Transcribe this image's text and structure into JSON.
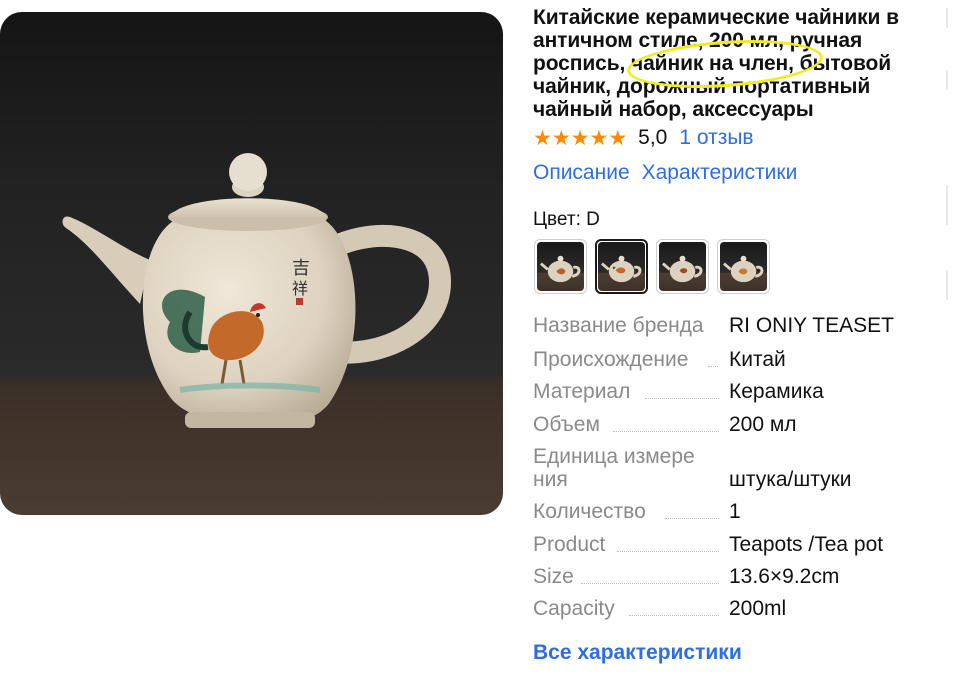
{
  "product": {
    "title": "Китайские керамические чайники в античном стиле, 200 мл, ручная роспись, чайник на член, бытовой чайник, дорожный портативный чайный набор, аксессуары",
    "image_alt": "керамический чайник с петухом"
  },
  "rating": {
    "stars": [
      "★",
      "★",
      "★",
      "★",
      "★"
    ],
    "value": "5,0",
    "reviews": "1 отзыв",
    "star_color": "#ff8a00"
  },
  "tabs": {
    "description": "Описание",
    "characteristics": "Характеристики"
  },
  "color_selector": {
    "label": "Цвет: D",
    "options": [
      "teapot-swatch-1",
      "teapot-swatch-2",
      "teapot-swatch-3",
      "teapot-swatch-4"
    ],
    "selected_index": 1
  },
  "specs": [
    {
      "key": "Название бренда",
      "value": "RI ONIY TEASET"
    },
    {
      "key": "Происхождение",
      "value": "Китай"
    },
    {
      "key": "Материал",
      "value": "Керамика"
    },
    {
      "key": "Объем",
      "value": "200 мл"
    },
    {
      "key": "Единица измере ния",
      "value": "штука/штуки"
    },
    {
      "key": "Количество",
      "value": "1"
    },
    {
      "key": "Product",
      "value": "Teapots /Tea pot"
    },
    {
      "key": "Size",
      "value": "13.6×9.2cm"
    },
    {
      "key": "Capacity",
      "value": "200ml"
    }
  ],
  "all_specs_link": "Все характеристики",
  "colors": {
    "link": "#2d6ee6",
    "highlight": "#f2ec1f",
    "muted_text": "#8a8a8a"
  }
}
